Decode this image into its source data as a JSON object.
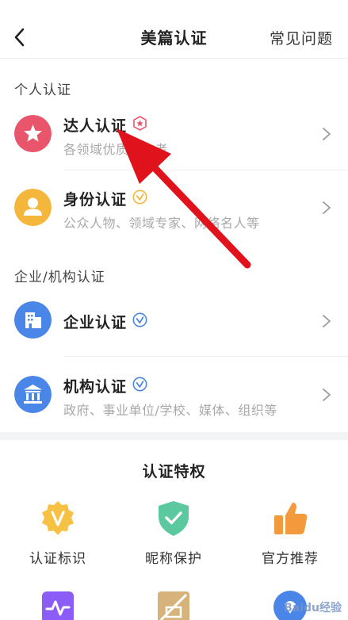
{
  "header": {
    "title": "美篇认证",
    "faq_label": "常见问题"
  },
  "personal": {
    "section_label": "个人认证",
    "items": [
      {
        "name": "达人认证",
        "desc": "各领域优质创作者",
        "icon": "star-icon",
        "badge": "red-star-badge-icon",
        "color": "#e9566b"
      },
      {
        "name": "身份认证",
        "desc": "公众人物、领域专家、网络名人等",
        "icon": "person-icon",
        "badge": "yellow-check-badge-icon",
        "color": "#f5b73b"
      }
    ]
  },
  "enterprise": {
    "section_label": "企业/机构认证",
    "items": [
      {
        "name": "企业认证",
        "desc": "",
        "icon": "building-icon",
        "badge": "blue-check-badge-icon",
        "color": "#4a86e8"
      },
      {
        "name": "机构认证",
        "desc": "政府、事业单位/学校、媒体、组织等",
        "icon": "institution-icon",
        "badge": "blue-check-badge-icon",
        "color": "#4a86e8"
      }
    ]
  },
  "privileges": {
    "title": "认证特权",
    "items": [
      {
        "label": "认证标识",
        "icon": "v-badge-icon",
        "color": "#f7c143"
      },
      {
        "label": "昵称保护",
        "icon": "shield-check-icon",
        "color": "#5bc8a0"
      },
      {
        "label": "官方推荐",
        "icon": "thumbs-up-icon",
        "color": "#f39a3c"
      },
      {
        "label": "",
        "icon": "pulse-icon",
        "color": "#8b5cf6"
      },
      {
        "label": "",
        "icon": "no-ads-icon",
        "color": "#d6b37a"
      },
      {
        "label": "",
        "icon": "blue-icon",
        "color": "#4a86e8"
      }
    ]
  },
  "watermark": "Baidu经验"
}
